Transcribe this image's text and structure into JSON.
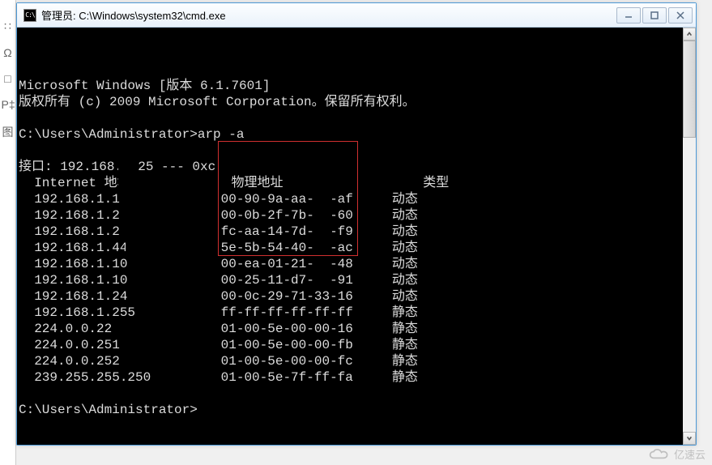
{
  "left_panel": {
    "items": [
      "∷",
      "Ω",
      "□",
      "P‡",
      "图"
    ]
  },
  "window": {
    "icon_glyph": "C:\\",
    "title": "管理员: C:\\Windows\\system32\\cmd.exe"
  },
  "terminal": {
    "preamble": [
      "Microsoft Windows [版本 6.1.7601]",
      "版权所有 (c) 2009 Microsoft Corporation。保留所有权利。",
      "",
      "C:\\Users\\Administrator>arp -a",
      "",
      "接口: 192.168.1.25 --- 0xc"
    ],
    "headers": {
      "ip": "Internet 地址",
      "mac": "物理地址",
      "type": "类型"
    },
    "rows": [
      {
        "ip": "192.168.1.1",
        "mac": "00-90-9a-aa-  -af",
        "type": "动态",
        "boxed": true,
        "mask_ip": false,
        "mask_mac": true
      },
      {
        "ip": "192.168.1.2",
        "mac": "00-0b-2f-7b-  -60",
        "type": "动态",
        "boxed": true,
        "mask_ip": true,
        "mask_mac": true
      },
      {
        "ip": "192.168.1.2",
        "mac": "fc-aa-14-7d-  -f9",
        "type": "动态",
        "boxed": true,
        "mask_ip": true,
        "mask_mac": true
      },
      {
        "ip": "192.168.1.44",
        "mac": "5e-5b-54-40-  -ac",
        "type": "动态",
        "boxed": true,
        "mask_ip": true,
        "mask_mac": true
      },
      {
        "ip": "192.168.1.10",
        "mac": "00-ea-01-21-  -48",
        "type": "动态",
        "boxed": true,
        "mask_ip": true,
        "mask_mac": true
      },
      {
        "ip": "192.168.1.10",
        "mac": "00-25-11-d7-  -91",
        "type": "动态",
        "boxed": true,
        "mask_ip": true,
        "mask_mac": true
      },
      {
        "ip": "192.168.1.24",
        "mac": "00-0c-29-71-33-16",
        "type": "动态",
        "boxed": true,
        "mask_ip": true,
        "mask_mac": false
      },
      {
        "ip": "192.168.1.255",
        "mac": "ff-ff-ff-ff-ff-ff",
        "type": "静态",
        "boxed": false,
        "mask_ip": false,
        "mask_mac": false
      },
      {
        "ip": "224.0.0.22",
        "mac": "01-00-5e-00-00-16",
        "type": "静态",
        "boxed": false,
        "mask_ip": false,
        "mask_mac": false
      },
      {
        "ip": "224.0.0.251",
        "mac": "01-00-5e-00-00-fb",
        "type": "静态",
        "boxed": false,
        "mask_ip": false,
        "mask_mac": false
      },
      {
        "ip": "224.0.0.252",
        "mac": "01-00-5e-00-00-fc",
        "type": "静态",
        "boxed": false,
        "mask_ip": false,
        "mask_mac": false
      },
      {
        "ip": "239.255.255.250",
        "mac": "01-00-5e-7f-ff-fa",
        "type": "静态",
        "boxed": false,
        "mask_ip": false,
        "mask_mac": false
      }
    ],
    "trailing": [
      "",
      "C:\\Users\\Administrator>"
    ],
    "columns": {
      "ip_start": 2,
      "mac_start": 26,
      "type_start": 48
    }
  },
  "watermark": {
    "text": "亿速云"
  }
}
